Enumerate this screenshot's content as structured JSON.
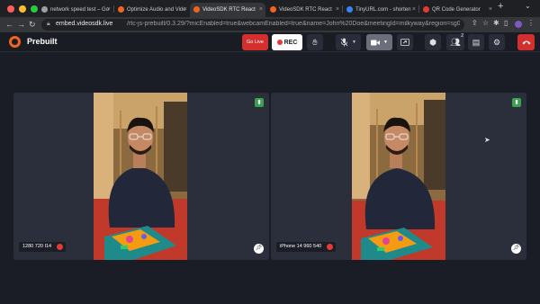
{
  "browser": {
    "tabs": [
      {
        "label": "network speed test – Go",
        "favicon_color": "#9aa0a6",
        "active": false
      },
      {
        "label": "Optimize Audio and Vide",
        "favicon_color": "#f0641e",
        "active": false
      },
      {
        "label": "VideoSDK RTC React",
        "favicon_color": "#f0641e",
        "active": true
      },
      {
        "label": "VideoSDK RTC React",
        "favicon_color": "#f0641e",
        "active": false
      },
      {
        "label": "TinyURL.com - shorten",
        "favicon_color": "#3b82f6",
        "active": false
      },
      {
        "label": "QR Code Generator",
        "favicon_color": "#e53935",
        "active": false
      }
    ],
    "close_glyph": "×",
    "new_tab_glyph": "+",
    "url": {
      "host": "embed.videosdk.live",
      "path": "/rtc-js-prebuilt/0.3.29/?micEnabled=true&webcamEnabled=true&name=John%20Doe&meetingId=milkyway&region=sg001&preferredPro..."
    }
  },
  "app": {
    "title": "Prebuilt",
    "accent_color": "#f0641e",
    "go_live_label": "Go Live",
    "rec_label": "REC",
    "participants_count": "2"
  },
  "participants": [
    {
      "name_label": "1280 720 I14",
      "network": "good",
      "mic": "off"
    },
    {
      "name_label": "iPhone 14 960 540",
      "network": "good",
      "mic": "off"
    }
  ],
  "icons": {
    "lock": "lock-icon",
    "raise_hand": "hand-icon",
    "mic": "mic-off-icon",
    "webcam": "video-camera-icon",
    "screen_share": "screen-share-icon",
    "whiteboard": "cube-icon",
    "participants": "people-icon",
    "chat": "chat-icon",
    "settings": "gear-icon",
    "leave": "phone-hangup-icon",
    "pin": "pin-icon"
  }
}
